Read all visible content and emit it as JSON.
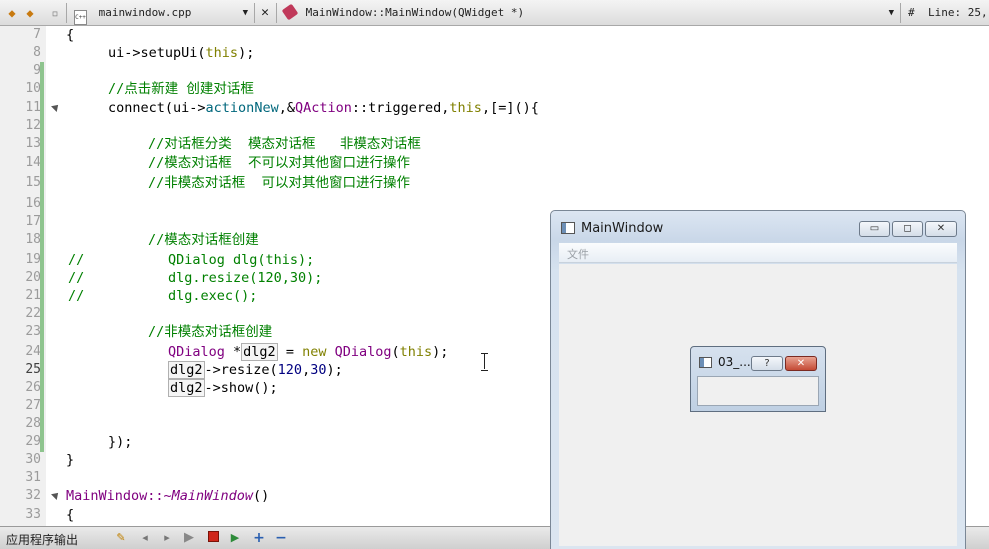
{
  "toolbar": {
    "file_name": "mainwindow.cpp",
    "file_icon": "C++",
    "function_name": "MainWindow::MainWindow(QWidget *)",
    "hash": "#",
    "line_info": "Line: 25,",
    "dropdown_arrow": "▼",
    "close_glyph": "✕"
  },
  "editor": {
    "line_numbers": [
      "7",
      "8",
      "9",
      "10",
      "11",
      "12",
      "13",
      "14",
      "15",
      "16",
      "17",
      "18",
      "19",
      "20",
      "21",
      "22",
      "23",
      "24",
      "25",
      "26",
      "27",
      "28",
      "29",
      "30",
      "31",
      "32",
      "33"
    ],
    "current_line": "25",
    "lines": {
      "l7_brace": "{",
      "l8_a": "ui->setupUi(",
      "l8_this": "this",
      "l8_b": ");",
      "l10_comment": "//点击新建 创建对话框",
      "l11_connect": "connect",
      "l11_a": "(ui->",
      "l11_fn": "actionNew",
      "l11_b": ",&",
      "l11_type": "QAction",
      "l11_c": "::triggered,",
      "l11_this": "this",
      "l11_d": ",[=](){",
      "l13_comment": "//对话框分类  模态对话框   非模态对话框",
      "l14_comment": "//模态对话框  不可以对其他窗口进行操作",
      "l15_comment": "//非模态对话框  可以对其他窗口进行操作",
      "l18_comment": "//模态对话框创建",
      "l19_slash": "//",
      "l19_code": "QDialog dlg(this);",
      "l20_slash": "//",
      "l20_code": "dlg.resize(120,30);",
      "l21_slash": "//",
      "l21_code": "dlg.exec();",
      "l23_comment": "//非模态对话框创建",
      "l24_type": "QDialog",
      "l24_star": " *",
      "l24_var": "dlg2",
      "l24_eq": " = ",
      "l24_new": "new",
      "l24_sp": " ",
      "l24_type2": "QDialog",
      "l24_open": "(",
      "l24_this": "this",
      "l24_close": ");",
      "l25_var": "dlg2",
      "l25_a": "->resize(",
      "l25_n1": "120",
      "l25_comma": ",",
      "l25_n2": "30",
      "l25_b": ");",
      "l26_var": "dlg2",
      "l26_a": "->show();",
      "l29_close": "});",
      "l30_brace": "}",
      "l32_a": "MainWindow::~",
      "l32_b": "MainWindow",
      "l32_c": "()",
      "l33_brace": "{"
    }
  },
  "bottombar": {
    "title": "应用程序输出"
  },
  "main_window": {
    "title": "MainWindow",
    "menu_file": "文件",
    "minimize_glyph": "▭",
    "maximize_glyph": "◻",
    "close_glyph": "✕"
  },
  "dialog": {
    "title": "03_...",
    "help_glyph": "?",
    "close_glyph": "✕"
  },
  "colors": {
    "keyword": "#808000",
    "type": "#800080",
    "comment": "#008000",
    "function": "#00677c"
  }
}
